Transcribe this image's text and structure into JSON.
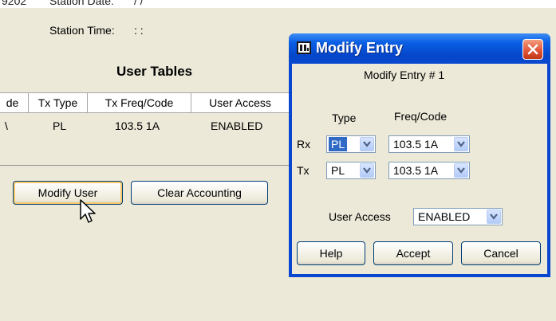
{
  "background": {
    "top_left_fragment": "9202",
    "station_date_label": "Station Date:",
    "station_date_value": "/ /",
    "station_time_label": "Station Time:",
    "station_time_value": ": :",
    "section_title": "User Tables",
    "table": {
      "columns": [
        "de",
        "Tx Type",
        "Tx Freq/Code",
        "User Access"
      ],
      "row": [
        "\\",
        "PL",
        "103.5  1A",
        "ENABLED"
      ]
    },
    "buttons": {
      "modify_user": "Modify User",
      "clear_accounting": "Clear Accounting"
    }
  },
  "dialog": {
    "title": "Modify Entry",
    "subtitle": "Modify Entry #  1",
    "header_type": "Type",
    "header_freq": "Freq/Code",
    "rx_label": "Rx",
    "tx_label": "Tx",
    "rx_type": "PL",
    "rx_freq": "103.5  1A",
    "tx_type": "PL",
    "tx_freq": "103.5  1A",
    "user_access_label": "User Access",
    "user_access_value": "ENABLED",
    "buttons": {
      "help": "Help",
      "accept": "Accept",
      "cancel": "Cancel"
    }
  },
  "icons": [
    "app-icon",
    "close-icon",
    "dropdown-arrow-icon",
    "mouse-cursor-icon"
  ],
  "colors": {
    "title_bar": "#0a5fe4",
    "window_bg": "#ece9d8",
    "close_button": "#e2573a",
    "selection": "#316ac5"
  }
}
